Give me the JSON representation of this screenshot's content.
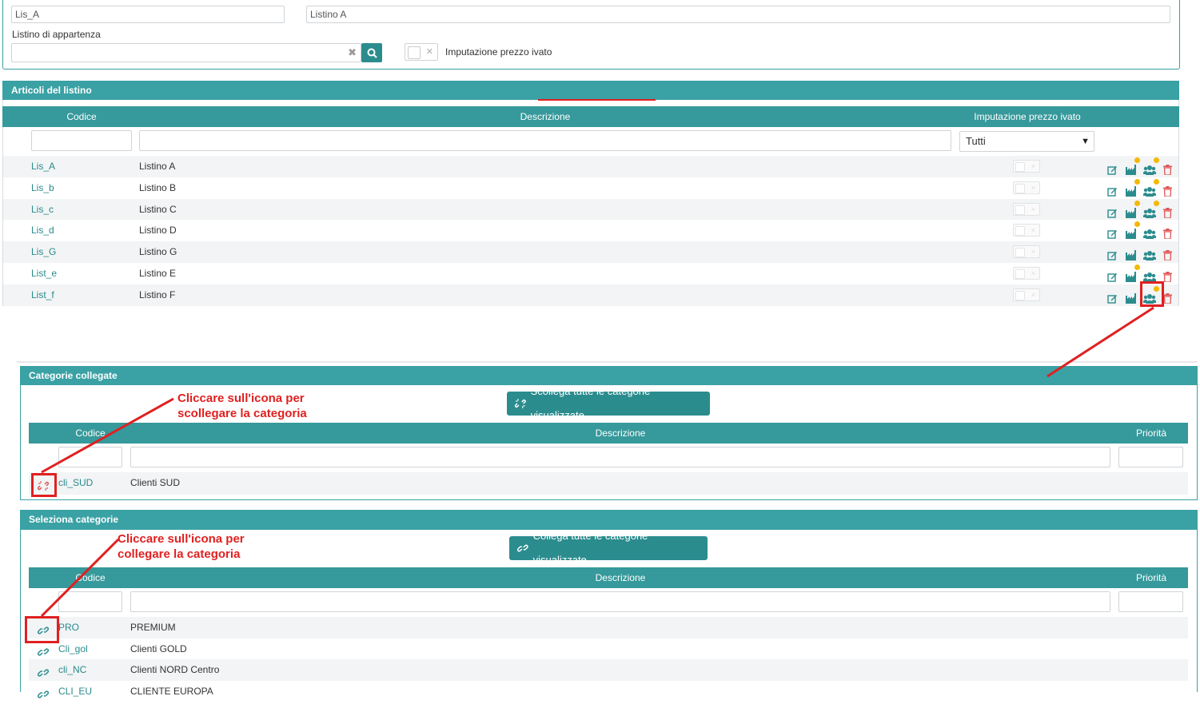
{
  "header": {
    "codice_value": "Lis_A",
    "descrizione_value": "Listino A",
    "listino_label": "Listino di appartenza",
    "listino_value": "",
    "imputazione_label": "Imputazione prezzo ivato"
  },
  "articoli": {
    "title": "Articoli del listino",
    "col_codice": "Codice",
    "col_descrizione": "Descrizione",
    "col_imputazione": "Imputazione prezzo ivato",
    "filter_select": "Tutti",
    "rows": [
      {
        "code": "Lis_A",
        "desc": "Listino A"
      },
      {
        "code": "Lis_b",
        "desc": "Listino B"
      },
      {
        "code": "Lis_c",
        "desc": "Listino C"
      },
      {
        "code": "Lis_d",
        "desc": "Listino D"
      },
      {
        "code": "Lis_G",
        "desc": "Listino G"
      },
      {
        "code": "List_e",
        "desc": "Listino E"
      },
      {
        "code": "List_f",
        "desc": "Listino F"
      }
    ]
  },
  "categorie_collegate": {
    "title": "Categorie collegate",
    "button": "Scollega tutte le categorie visualizzate",
    "col_codice": "Codice",
    "col_descrizione": "Descrizione",
    "col_priorita": "Priorità",
    "rows": [
      {
        "code": "cli_SUD",
        "desc": "Clienti SUD"
      }
    ]
  },
  "seleziona_categorie": {
    "title": "Seleziona categorie",
    "button": "Collega tutte le categorie visualizzate",
    "col_codice": "Codice",
    "col_descrizione": "Descrizione",
    "col_priorita": "Priorità",
    "rows": [
      {
        "code": "PRO",
        "desc": "PREMIUM"
      },
      {
        "code": "Cli_gol",
        "desc": "Clienti GOLD"
      },
      {
        "code": "cli_NC",
        "desc": "Clienti NORD Centro"
      },
      {
        "code": "CLI_EU",
        "desc": "CLIENTE EUROPA"
      }
    ]
  },
  "annotations": {
    "unlink_line1": "Cliccare sull'icona per",
    "unlink_line2": "scollegare la categoria",
    "link_line1": "Cliccare sull'icona per",
    "link_line2": "collegare la categoria"
  },
  "icons": {
    "search": "search-icon",
    "edit": "edit-icon",
    "factory": "factory-icon",
    "users": "users-icon",
    "delete": "trash-icon",
    "unlink": "unlink-icon",
    "link": "link-icon"
  },
  "colors": {
    "teal": "#3aa1a4",
    "teal_dark": "#2b8c8e",
    "annotation_red": "#e02020",
    "badge_yellow": "#f5b800",
    "delete_red": "#e05555"
  }
}
